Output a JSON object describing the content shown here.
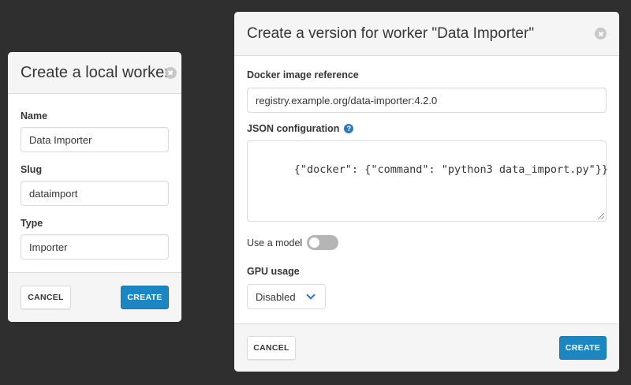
{
  "local_worker_modal": {
    "title": "Create a local worker",
    "fields": {
      "name": {
        "label": "Name",
        "value": "Data Importer"
      },
      "slug": {
        "label": "Slug",
        "value": "dataimport"
      },
      "type": {
        "label": "Type",
        "value": "Importer"
      }
    },
    "cancel_label": "CANCEL",
    "create_label": "CREATE"
  },
  "version_modal": {
    "title": "Create a version for worker \"Data Importer\"",
    "docker": {
      "label": "Docker image reference",
      "value": "registry.example.org/data-importer:4.2.0"
    },
    "json": {
      "label": "JSON configuration",
      "value": "{\"docker\": {\"command\": \"python3 data_import.py\"}}"
    },
    "model": {
      "label": "Use a model",
      "enabled": false
    },
    "gpu": {
      "label": "GPU usage",
      "value": "Disabled"
    },
    "cancel_label": "CANCEL",
    "create_label": "CREATE"
  },
  "icons": {
    "close": "close-icon",
    "help": "help-icon",
    "chevron": "chevron-down-icon"
  },
  "colors": {
    "primary": "#1c86c2",
    "backdrop": "#2f2f2f"
  }
}
